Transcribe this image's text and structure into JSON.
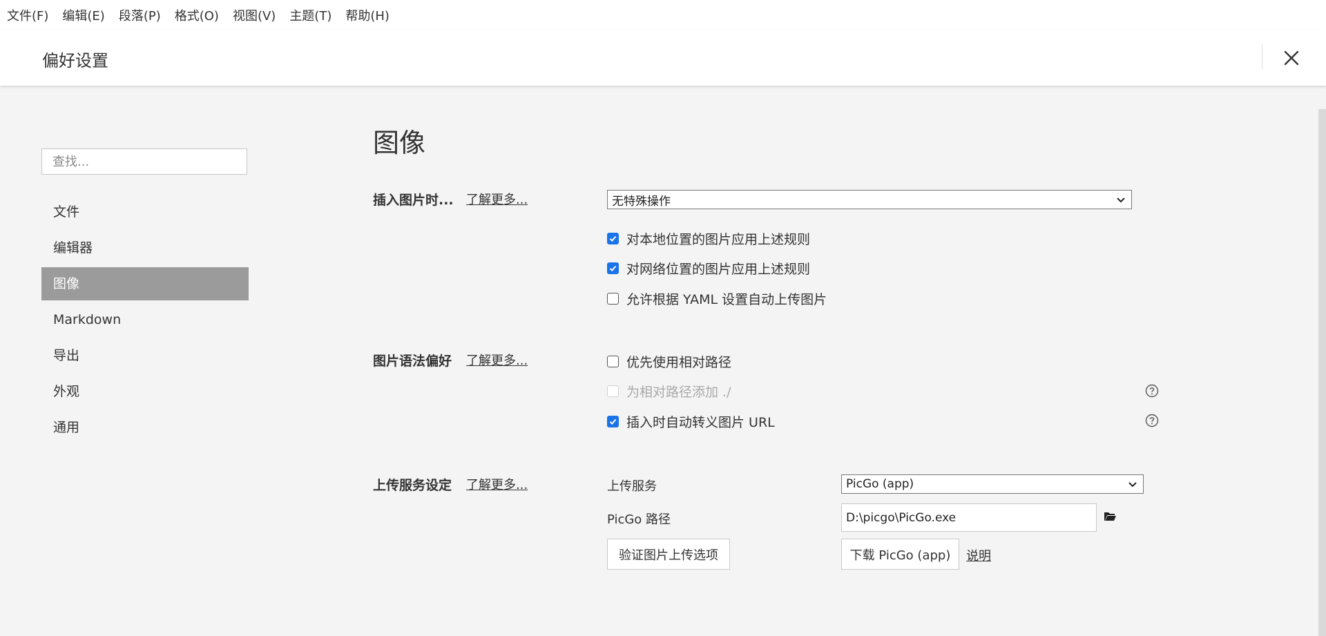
{
  "menubar": {
    "items": [
      "文件(F)",
      "编辑(E)",
      "段落(P)",
      "格式(O)",
      "视图(V)",
      "主题(T)",
      "帮助(H)"
    ]
  },
  "header": {
    "title": "偏好设置"
  },
  "sidebar": {
    "search_placeholder": "查找...",
    "items": [
      "文件",
      "编辑器",
      "图像",
      "Markdown",
      "导出",
      "外观",
      "通用"
    ],
    "active_index": 2
  },
  "main": {
    "title": "图像",
    "learn_more": "了解更多...",
    "insert": {
      "label": "插入图片时...",
      "select_value": "无特殊操作",
      "options": [
        {
          "label": "对本地位置的图片应用上述规则",
          "state": "checked"
        },
        {
          "label": "对网络位置的图片应用上述规则",
          "state": "checked"
        },
        {
          "label": "允许根据 YAML 设置自动上传图片",
          "state": "unchecked"
        }
      ]
    },
    "syntax": {
      "label": "图片语法偏好",
      "options": [
        {
          "label": "优先使用相对路径",
          "state": "unchecked"
        },
        {
          "label": "为相对路径添加 ./",
          "state": "disabled"
        },
        {
          "label": "插入时自动转义图片 URL",
          "state": "checked"
        }
      ]
    },
    "upload": {
      "label": "上传服务设定",
      "service_label": "上传服务",
      "service_value": "PicGo (app)",
      "path_label": "PicGo 路径",
      "path_value": "D:\\picgo\\PicGo.exe",
      "verify_button": "验证图片上传选项",
      "download_button": "下载 PicGo (app)",
      "explain_link": "说明"
    }
  },
  "colors": {
    "accent": "#1a73e8",
    "sidebar_active_bg": "#9b9b9b",
    "content_bg": "#f4f4f4"
  }
}
